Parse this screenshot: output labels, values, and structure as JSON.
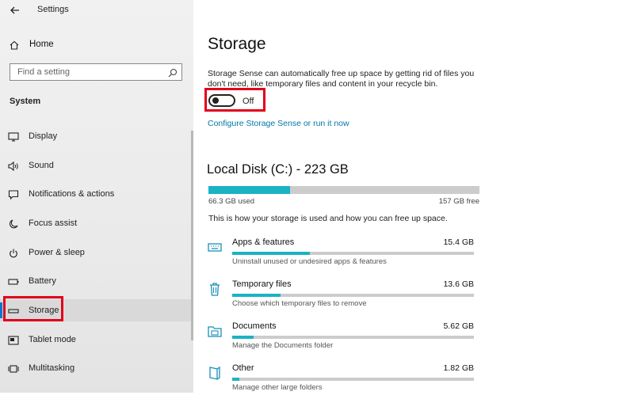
{
  "window": {
    "title": "Settings"
  },
  "sidebar": {
    "home_label": "Home",
    "search_placeholder": "Find a setting",
    "section_label": "System",
    "items": [
      {
        "label": "Display",
        "icon": "monitor-icon"
      },
      {
        "label": "Sound",
        "icon": "speaker-icon"
      },
      {
        "label": "Notifications & actions",
        "icon": "notification-icon"
      },
      {
        "label": "Focus assist",
        "icon": "moon-icon"
      },
      {
        "label": "Power & sleep",
        "icon": "power-icon"
      },
      {
        "label": "Battery",
        "icon": "battery-icon"
      },
      {
        "label": "Storage",
        "icon": "storage-icon",
        "selected": true
      },
      {
        "label": "Tablet mode",
        "icon": "tablet-icon"
      },
      {
        "label": "Multitasking",
        "icon": "multitasking-icon"
      }
    ]
  },
  "main": {
    "title": "Storage",
    "description": "Storage Sense can automatically free up space by getting rid of files you don't need, like temporary files and content in your recycle bin.",
    "toggle": {
      "state_label": "Off",
      "on": false
    },
    "configure_link": "Configure Storage Sense or run it now",
    "disk": {
      "title": "Local Disk (C:) - 223 GB",
      "used_label": "66.3 GB used",
      "free_label": "157 GB free",
      "used_fraction": 0.3
    },
    "usage_intro": "This is how your storage is used and how you can free up space.",
    "categories": [
      {
        "name": "Apps & features",
        "size": "15.4 GB",
        "sub": "Uninstall unused or undesired apps & features",
        "fraction": 0.32,
        "icon": "keyboard-icon"
      },
      {
        "name": "Temporary files",
        "size": "13.6 GB",
        "sub": "Choose which temporary files to remove",
        "fraction": 0.2,
        "icon": "trash-icon"
      },
      {
        "name": "Documents",
        "size": "5.62 GB",
        "sub": "Manage the Documents folder",
        "fraction": 0.09,
        "icon": "folder-icon"
      },
      {
        "name": "Other",
        "size": "1.82 GB",
        "sub": "Manage other large folders",
        "fraction": 0.03,
        "icon": "file-icon"
      }
    ]
  },
  "colors": {
    "accent": "#1ab3c3",
    "highlight": "#e0001b",
    "link": "#0078a8"
  }
}
